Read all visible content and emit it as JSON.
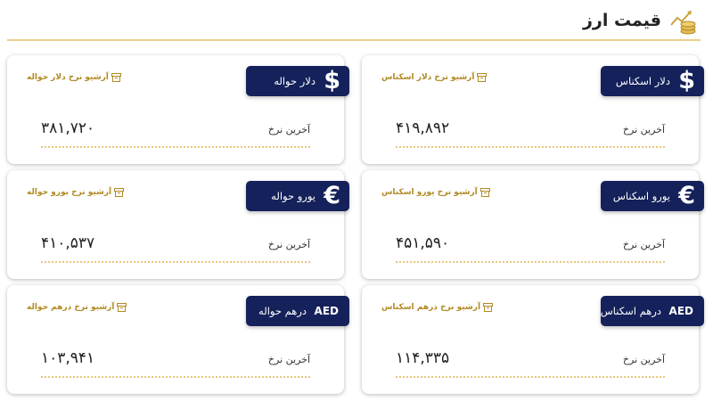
{
  "header": {
    "title": "قیمت ارز"
  },
  "common": {
    "rate_label": "آخرین نرخ"
  },
  "colors": {
    "badge_bg": "#14215a",
    "accent": "#b08a23",
    "dots": "#e6c77c"
  },
  "cards": [
    {
      "symbol": "$",
      "name": "دلار اسکناس",
      "archive": "آرشیو نرخ دلار اسکناس",
      "value": "۴۱۹,۸۹۲"
    },
    {
      "symbol": "$",
      "name": "دلار حواله",
      "archive": "آرشیو نرخ دلار حواله",
      "value": "۳۸۱,۷۲۰"
    },
    {
      "symbol": "€",
      "name": "یورو اسکناس",
      "archive": "آرشیو نرخ یورو اسکناس",
      "value": "۴۵۱,۵۹۰"
    },
    {
      "symbol": "€",
      "name": "یورو حواله",
      "archive": "آرشیو نرخ یورو حواله",
      "value": "۴۱۰,۵۳۷"
    },
    {
      "symbol": "AED",
      "name": "درهم اسکناس",
      "archive": "آرشیو نرخ درهم اسکناس",
      "value": "۱۱۴,۳۳۵"
    },
    {
      "symbol": "AED",
      "name": "درهم حواله",
      "archive": "آرشیو نرخ درهم حواله",
      "value": "۱۰۳,۹۴۱"
    }
  ]
}
